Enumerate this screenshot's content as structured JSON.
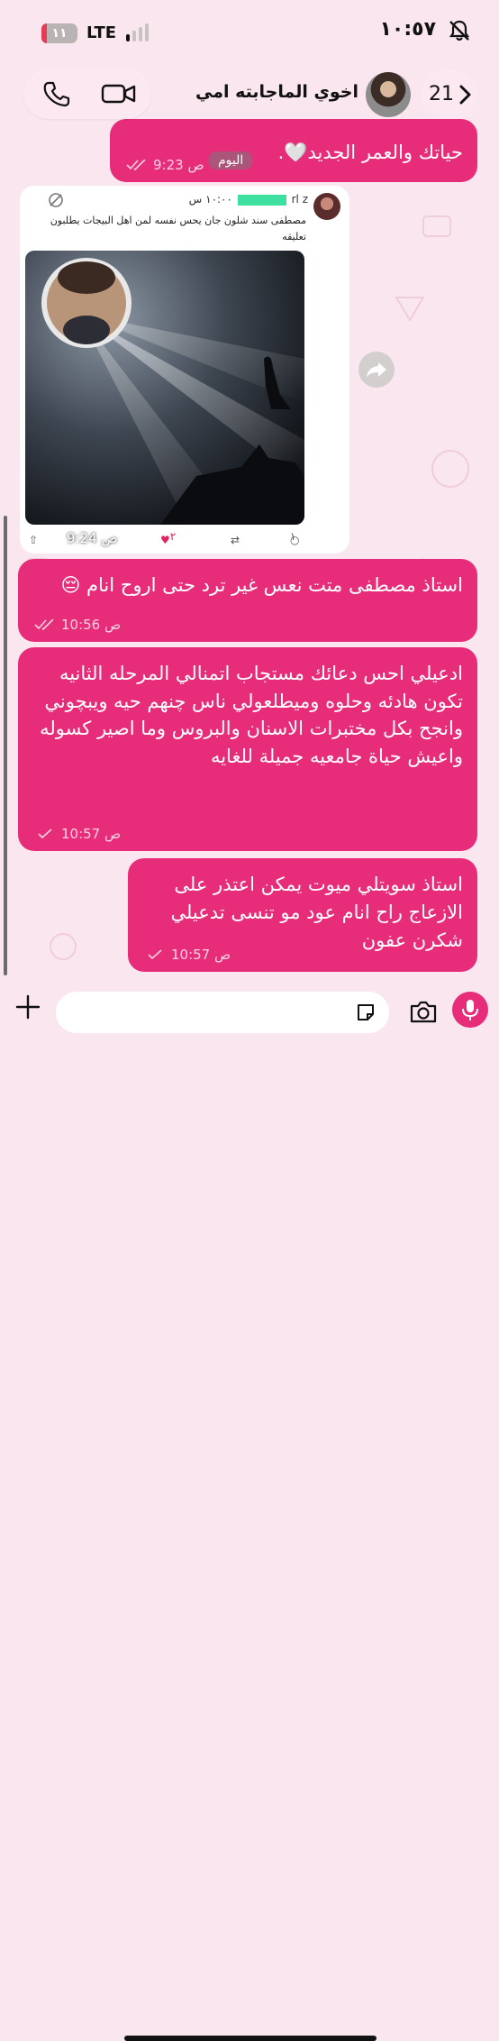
{
  "status_bar": {
    "time": "١٠:٥٧",
    "battery_level": "١١",
    "battery_fraction": 0.11,
    "network": "LTE",
    "mute_icon": "bell-slash-icon"
  },
  "header": {
    "title": "اخوي الماجابته امي",
    "back_count": "21",
    "icons": [
      "phone-icon",
      "video-camera-icon",
      "chevron-left-icon"
    ]
  },
  "date_chip": "اليوم",
  "messages": [
    {
      "text": "حياتك والعمر الجديد🤍.",
      "time": "9:23 ص"
    },
    {
      "text": "استاذ مصطفى متت نعس غير ترد  حتى اروح انام 😔",
      "time": "10:56 ص"
    },
    {
      "text": "ادعيلي احس دعائك مستجاب اتمنالي المرحله الثانيه تكون هادئه وحلوه وميطلعولي ناس چنهم حيه ويبچوني وانجح بكل مختبرات الاسنان والبروس وما اصير كسوله واعيش حياة جامعيه جميلة للغايه",
      "time": "10:57 ص"
    },
    {
      "text": "استاذ سويتلي ميوت يمكن اعتذر على الازعاج راح انام عود مو تنسى تدعيلي شكرن عفون",
      "time": "10:57 ص"
    }
  ],
  "media_card": {
    "post_meta": "١٠:٠٠ س",
    "user_fragment": "rl z",
    "post_text": "مصطفى سند شلون جان يحس نفسه لمن اهل البيجات يطلبون تعليقه",
    "reply_count": "١",
    "like_count": "٢",
    "time": "9:24 ص",
    "like_color": "#e0245e"
  },
  "input": {
    "placeholder": "",
    "icons": [
      "plus-icon",
      "sticker-icon",
      "camera-icon",
      "microphone-icon"
    ]
  },
  "colors": {
    "bubble": "#e72c7a",
    "background": "#f9e6ee",
    "pill": "#fbe8f1"
  }
}
